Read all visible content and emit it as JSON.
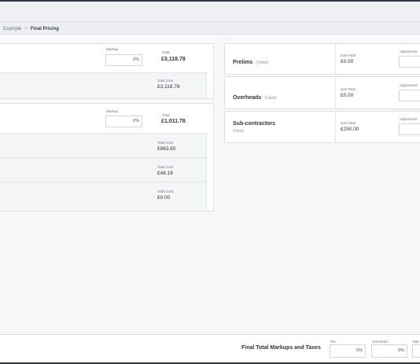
{
  "breadcrumb": {
    "parent": "Example",
    "separator": ">",
    "current": "Final Pricing"
  },
  "left_panel_1": {
    "markup_label": "Markup",
    "markup_value": "0%",
    "total_label": "Total",
    "total_value": "£3,118.78",
    "rows": [
      {
        "cost_label": "Total Cost",
        "cost_value": "£3,118.78"
      }
    ]
  },
  "left_panel_2": {
    "markup_label": "Markup",
    "markup_value": "0%",
    "total_label": "Total",
    "total_value": "£1,011.78",
    "rows": [
      {
        "cost_label": "Total Cost",
        "cost_value": "£963.60"
      },
      {
        "cost_label": "Total Cost",
        "cost_value": "£48.18"
      },
      {
        "cost_label": "Total Cost",
        "cost_value": "£0.00"
      }
    ]
  },
  "right_panels": [
    {
      "title": "Prelims",
      "view": "(View)",
      "subtotal_label": "Sub-Total",
      "subtotal_value": "£0.00",
      "adjustment_label": "Adjustment"
    },
    {
      "title": "Overheads",
      "view": "(View)",
      "subtotal_label": "Sub-Total",
      "subtotal_value": "£0.00",
      "adjustment_label": "Adjustment"
    },
    {
      "title": "Sub-contractors",
      "view": "(View)",
      "subtotal_label": "Sub-Total",
      "subtotal_value": "£250.00",
      "adjustment_label": "Adjustment"
    }
  ],
  "footer": {
    "title": "Final Total Markups and Taxes",
    "tax_label": "Tax",
    "tax_value": "0%",
    "overhead_label": "Overhead",
    "overhead_value": "0%",
    "markup_label": "Mar"
  }
}
